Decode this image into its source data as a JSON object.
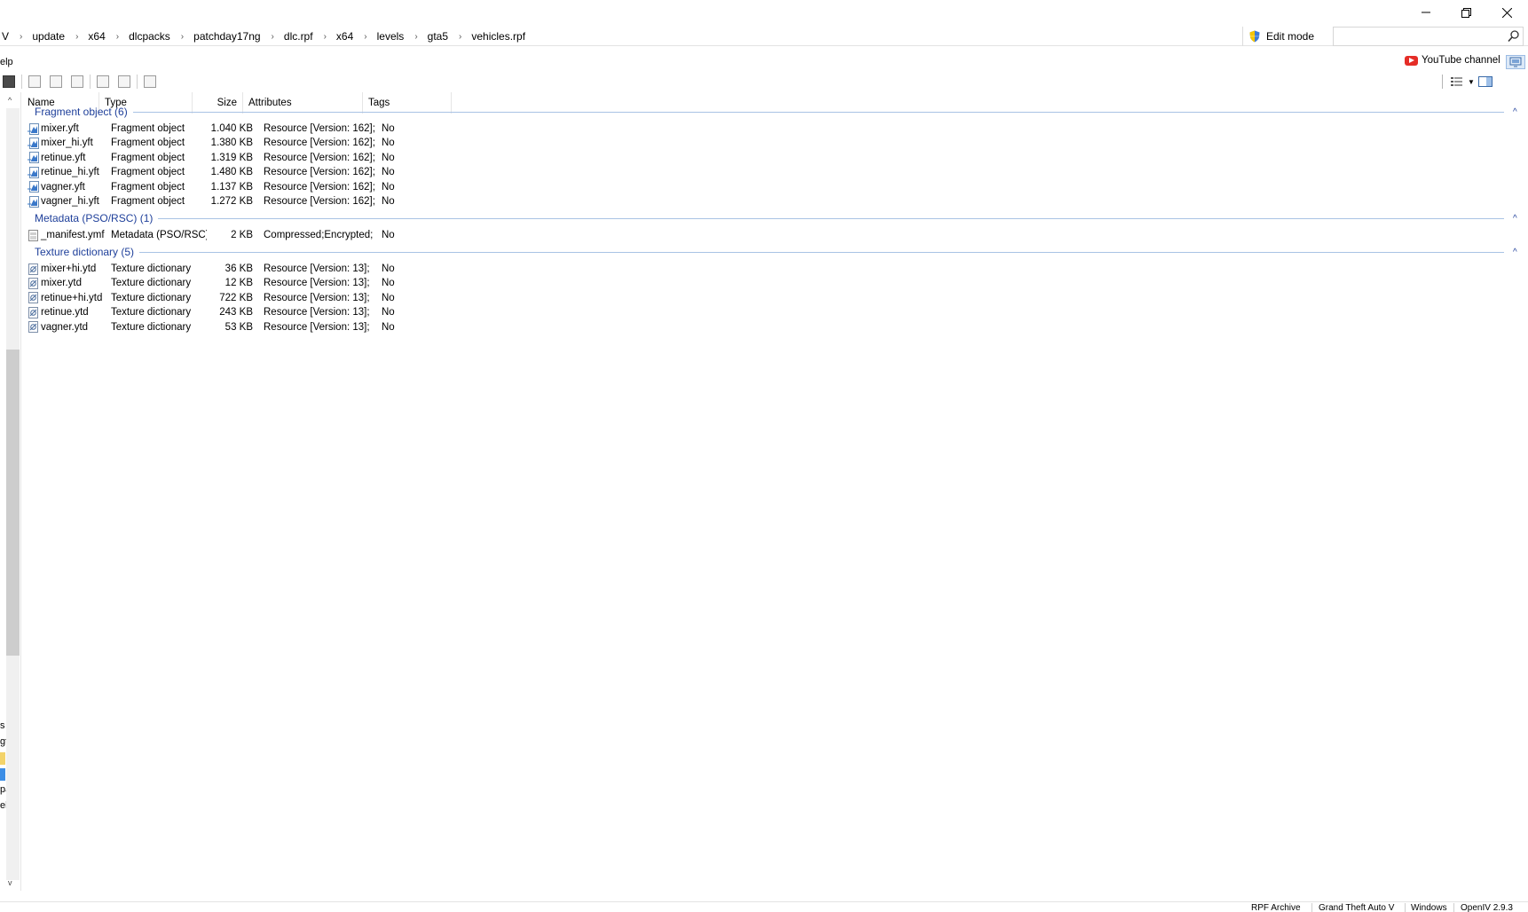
{
  "window": {
    "minimize_icon": "minimize-icon",
    "restore_icon": "restore-icon",
    "close_icon": "close-icon"
  },
  "breadcrumb": {
    "partial_left": "V",
    "items": [
      "update",
      "x64",
      "dlcpacks",
      "patchday17ng",
      "dlc.rpf",
      "x64",
      "levels",
      "gta5",
      "vehicles.rpf"
    ],
    "separator": "›"
  },
  "toolbar": {
    "edit_mode_label": "Edit mode",
    "search_placeholder": "",
    "youtube_label": "YouTube channel",
    "menu_partial": "elp"
  },
  "columns": {
    "name": "Name",
    "type": "Type",
    "size": "Size",
    "attributes": "Attributes",
    "tags": "Tags"
  },
  "groups": [
    {
      "title": "Fragment object (6)",
      "icon": "fragment-file-icon",
      "rows": [
        {
          "name": "mixer.yft",
          "type": "Fragment object",
          "size": "1.040 KB",
          "attributes": "Resource [Version: 162];",
          "tags": "No"
        },
        {
          "name": "mixer_hi.yft",
          "type": "Fragment object",
          "size": "1.380 KB",
          "attributes": "Resource [Version: 162];",
          "tags": "No"
        },
        {
          "name": "retinue.yft",
          "type": "Fragment object",
          "size": "1.319 KB",
          "attributes": "Resource [Version: 162];",
          "tags": "No"
        },
        {
          "name": "retinue_hi.yft",
          "type": "Fragment object",
          "size": "1.480 KB",
          "attributes": "Resource [Version: 162];",
          "tags": "No"
        },
        {
          "name": "vagner.yft",
          "type": "Fragment object",
          "size": "1.137 KB",
          "attributes": "Resource [Version: 162];",
          "tags": "No"
        },
        {
          "name": "vagner_hi.yft",
          "type": "Fragment object",
          "size": "1.272 KB",
          "attributes": "Resource [Version: 162];",
          "tags": "No"
        }
      ]
    },
    {
      "title": "Metadata (PSO/RSC) (1)",
      "icon": "metadata-file-icon",
      "rows": [
        {
          "name": "_manifest.ymf",
          "type": "Metadata (PSO/RSC)",
          "size": "2 KB",
          "attributes": "Compressed;Encrypted;",
          "tags": "No"
        }
      ]
    },
    {
      "title": "Texture dictionary (5)",
      "icon": "texture-file-icon",
      "rows": [
        {
          "name": "mixer+hi.ytd",
          "type": "Texture dictionary",
          "size": "36 KB",
          "attributes": "Resource [Version: 13];",
          "tags": "No"
        },
        {
          "name": "mixer.ytd",
          "type": "Texture dictionary",
          "size": "12 KB",
          "attributes": "Resource [Version: 13];",
          "tags": "No"
        },
        {
          "name": "retinue+hi.ytd",
          "type": "Texture dictionary",
          "size": "722 KB",
          "attributes": "Resource [Version: 13];",
          "tags": "No"
        },
        {
          "name": "retinue.ytd",
          "type": "Texture dictionary",
          "size": "243 KB",
          "attributes": "Resource [Version: 13];",
          "tags": "No"
        },
        {
          "name": "vagner.ytd",
          "type": "Texture dictionary",
          "size": "53 KB",
          "attributes": "Resource [Version: 13];",
          "tags": "No"
        }
      ]
    }
  ],
  "navpane": {
    "fragments": [
      "s",
      "gt",
      "pa",
      "el"
    ]
  },
  "statusbar": {
    "items": [
      "RPF Archive",
      "Grand Theft Auto V",
      "Windows",
      "OpenIV 2.9.3"
    ]
  },
  "colors": {
    "group_title": "#1e3f9a",
    "group_line": "#a9c3e4",
    "youtube_red": "#e52d27"
  }
}
